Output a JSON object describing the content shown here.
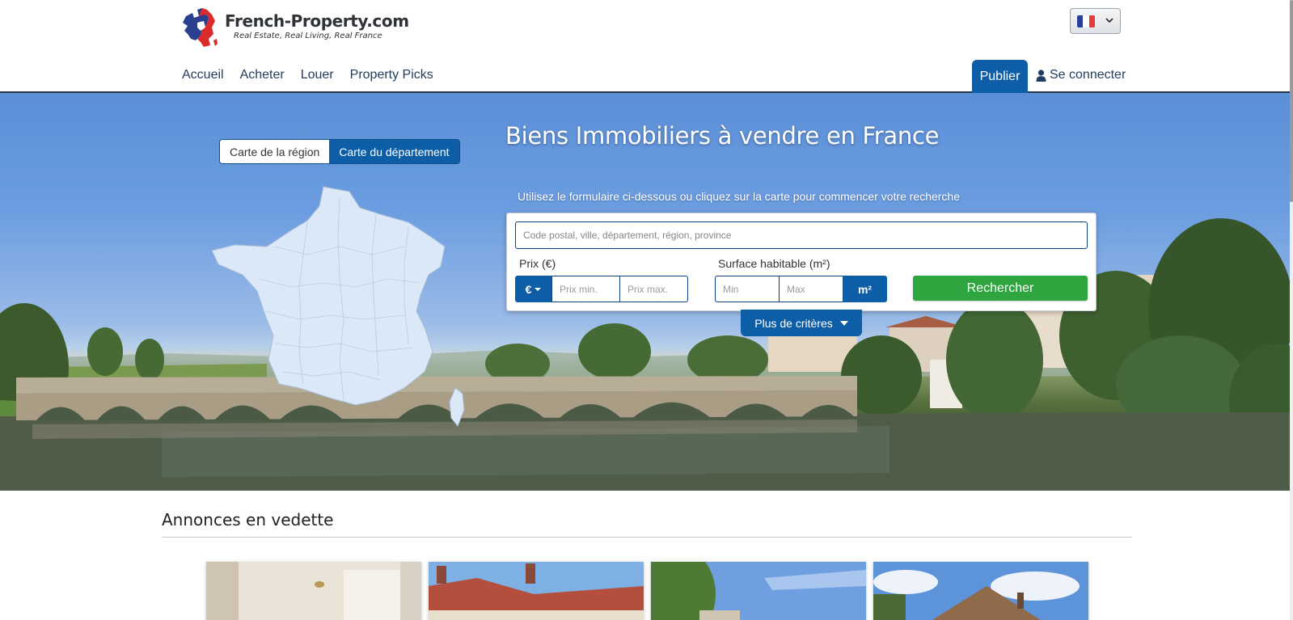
{
  "brand": {
    "name": "French-Property.com",
    "tagline": "Real Estate, Real Living, Real France"
  },
  "language": {
    "selected_icon": "france-flag-icon"
  },
  "nav": {
    "items": [
      {
        "label": "Accueil"
      },
      {
        "label": "Acheter"
      },
      {
        "label": "Louer"
      },
      {
        "label": "Property Picks"
      }
    ],
    "publish_label": "Publier",
    "login_label": "Se connecter"
  },
  "hero": {
    "title": "Biens Immobiliers à vendre en France",
    "map_tabs": [
      {
        "label": "Carte de la région",
        "active": false
      },
      {
        "label": "Carte du département",
        "active": true
      }
    ],
    "subtitle": "Utilisez le formulaire ci-dessous ou cliquez sur la carte pour commencer votre recherche"
  },
  "search": {
    "location_placeholder": "Code postal, ville, département, région, province",
    "price_label": "Prix (€)",
    "currency_label": "€",
    "price_min_placeholder": "Prix min.",
    "price_max_placeholder": "Prix max.",
    "area_label": "Surface habitable (m²)",
    "area_min_placeholder": "Min",
    "area_max_placeholder": "Max",
    "area_unit_label": "m²",
    "submit_label": "Rechercher",
    "more_label": "Plus de critères"
  },
  "featured": {
    "title": "Annonces en vedette"
  },
  "colors": {
    "primary": "#0d5da7",
    "success": "#2fa53f",
    "nav_text": "#1f3d5e"
  }
}
